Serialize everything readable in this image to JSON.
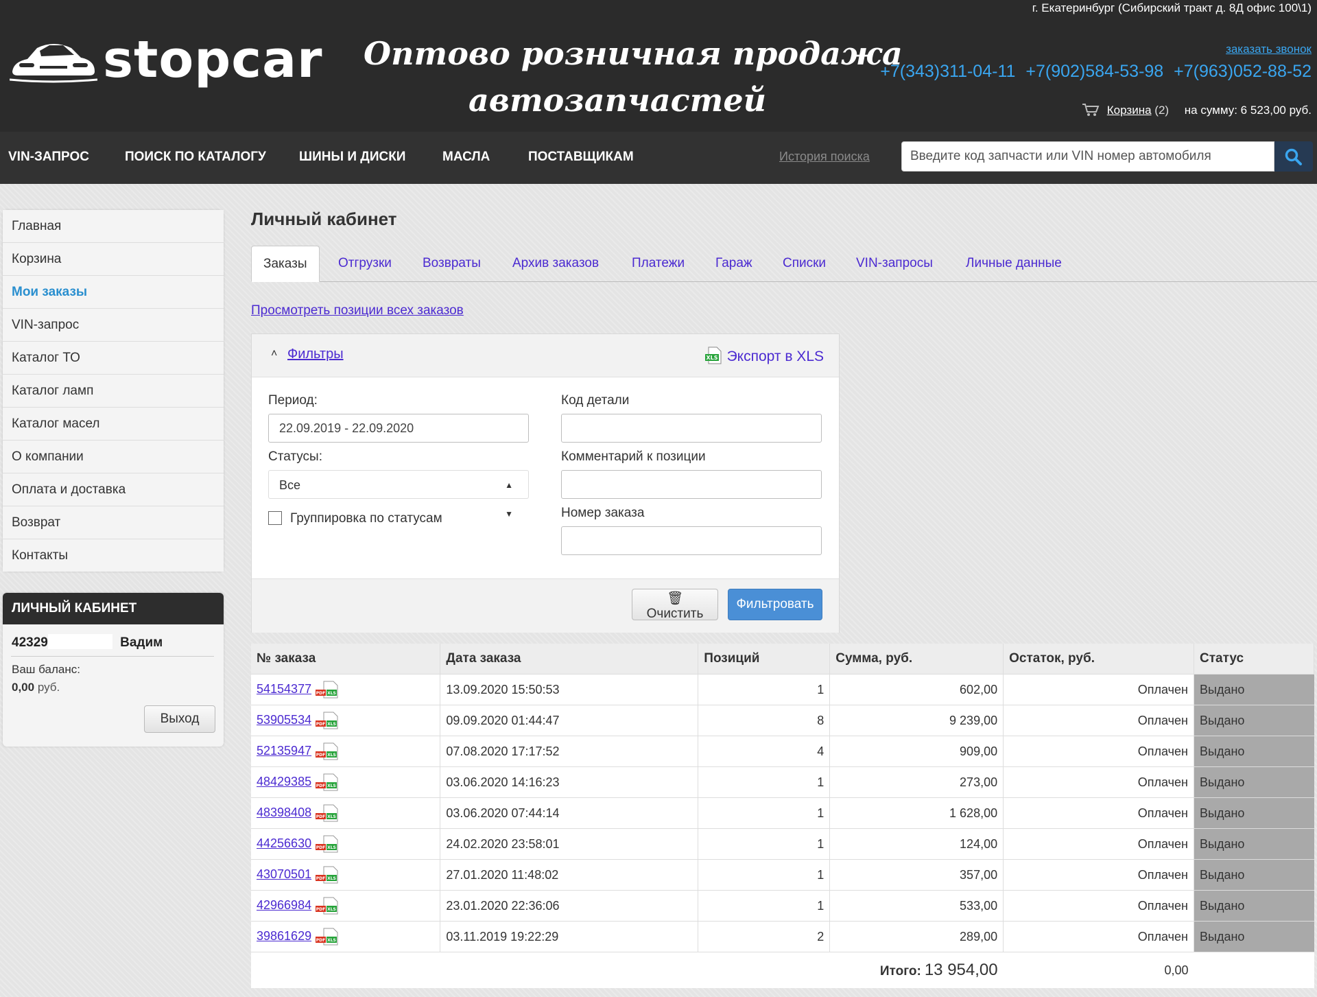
{
  "header": {
    "logo_text": "stopcar",
    "tagline_line1": "Оптово розничная продажа",
    "tagline_line2": "автозапчастей",
    "address": "г. Екатеринбург (Сибирский тракт д. 8Д офис 100\\1)",
    "callback_link": "заказать звонок",
    "phones": [
      "+7(343)311-04-11",
      "+7(902)584-53-98",
      "+7(963)052-88-52"
    ],
    "cart_link": "Корзина",
    "cart_count": "(2)",
    "cart_sum": "на сумму: 6 523,00 руб."
  },
  "nav": {
    "items": [
      "VIN-ЗАПРОС",
      "ПОИСК ПО КАТАЛОГУ",
      "ШИНЫ И ДИСКИ",
      "МАСЛА",
      "ПОСТАВЩИКАМ"
    ],
    "history_link": "История поиска",
    "search_placeholder": "Введите код запчасти или VIN номер автомобиля"
  },
  "sidebar": {
    "items": [
      "Главная",
      "Корзина",
      "Мои заказы",
      "VIN-запрос",
      "Каталог ТО",
      "Каталог ламп",
      "Каталог масел",
      "О компании",
      "Оплата и доставка",
      "Возврат",
      "Контакты"
    ],
    "active_index": 2,
    "cabinet_title": "ЛИЧНЫЙ КАБИНЕТ",
    "user_id": "42329",
    "user_name": "Вадим",
    "balance_label": "Ваш баланс:",
    "balance_value": "0,00",
    "balance_currency": "руб.",
    "logout_label": "Выход"
  },
  "main": {
    "title": "Личный кабинет",
    "tabs": [
      "Заказы",
      "Отгрузки",
      "Возвраты",
      "Архив заказов",
      "Платежи",
      "Гараж",
      "Списки",
      "VIN-запросы",
      "Личные данные"
    ],
    "active_tab": 0,
    "all_positions_link": "Просмотреть позиции всех заказов"
  },
  "filters": {
    "title": "Фильтры",
    "export_label": "Экспорт в XLS",
    "period_label": "Период:",
    "period_value": "22.09.2019 - 22.09.2020",
    "statuses_label": "Статусы:",
    "statuses_value": "Все",
    "group_label": "Группировка по статусам",
    "group_checked": false,
    "part_code_label": "Код детали",
    "part_code_value": "",
    "comment_label": "Комментарий к позиции",
    "comment_value": "",
    "order_no_label": "Номер заказа",
    "order_no_value": "",
    "clear_label": "Очистить",
    "filter_label": "Фильтровать"
  },
  "orders": {
    "headers": [
      "№ заказа",
      "Дата заказа",
      "Позиций",
      "Сумма, руб.",
      "Остаток, руб.",
      "Статус"
    ],
    "rows": [
      {
        "id": "54154377",
        "date": "13.09.2020 15:50:53",
        "positions": "1",
        "sum": "602,00",
        "remainder": "Оплачен",
        "status": "Выдано"
      },
      {
        "id": "53905534",
        "date": "09.09.2020 01:44:47",
        "positions": "8",
        "sum": "9 239,00",
        "remainder": "Оплачен",
        "status": "Выдано"
      },
      {
        "id": "52135947",
        "date": "07.08.2020 17:17:52",
        "positions": "4",
        "sum": "909,00",
        "remainder": "Оплачен",
        "status": "Выдано"
      },
      {
        "id": "48429385",
        "date": "03.06.2020 14:16:23",
        "positions": "1",
        "sum": "273,00",
        "remainder": "Оплачен",
        "status": "Выдано"
      },
      {
        "id": "48398408",
        "date": "03.06.2020 07:44:14",
        "positions": "1",
        "sum": "1 628,00",
        "remainder": "Оплачен",
        "status": "Выдано"
      },
      {
        "id": "44256630",
        "date": "24.02.2020 23:58:01",
        "positions": "1",
        "sum": "124,00",
        "remainder": "Оплачен",
        "status": "Выдано"
      },
      {
        "id": "43070501",
        "date": "27.01.2020 11:48:02",
        "positions": "1",
        "sum": "357,00",
        "remainder": "Оплачен",
        "status": "Выдано"
      },
      {
        "id": "42966984",
        "date": "23.01.2020 22:36:06",
        "positions": "1",
        "sum": "533,00",
        "remainder": "Оплачен",
        "status": "Выдано"
      },
      {
        "id": "39861629",
        "date": "03.11.2019 19:22:29",
        "positions": "2",
        "sum": "289,00",
        "remainder": "Оплачен",
        "status": "Выдано"
      }
    ],
    "total_label": "Итого:",
    "total_sum": "13 954,00",
    "total_remainder": "0,00"
  },
  "colors": {
    "header_bg": "#2b2b2b",
    "nav_bg": "#323232",
    "link": "#4b2ad1",
    "phone": "#3aa6f0",
    "active_menu": "#2a8fcf",
    "filter_button": "#4a8fd6",
    "status_cell": "#a9a9a9"
  }
}
